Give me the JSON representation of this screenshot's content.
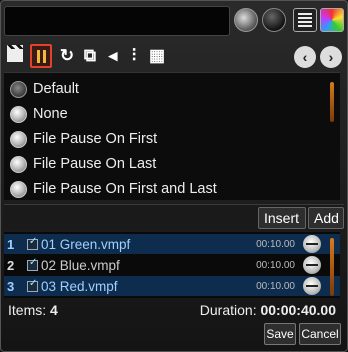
{
  "toolbar": {
    "icons": [
      "clapper-icon",
      "pause-icon",
      "refresh-icon",
      "insert-frame-icon",
      "reverse-icon",
      "split-icon",
      "film-icon"
    ],
    "active": "pause-icon"
  },
  "options": [
    {
      "label": "Default",
      "selected": true
    },
    {
      "label": "None",
      "selected": false
    },
    {
      "label": "File Pause On First",
      "selected": false
    },
    {
      "label": "File Pause On Last",
      "selected": false
    },
    {
      "label": "File Pause On First and Last",
      "selected": false
    }
  ],
  "list_buttons": {
    "insert": "Insert",
    "add": "Add"
  },
  "playlist": [
    {
      "num": "1",
      "name": "01 Green.vmpf",
      "duration": "00:10.00",
      "selected": true
    },
    {
      "num": "2",
      "name": "02 Blue.vmpf",
      "duration": "00:10.00",
      "selected": false
    },
    {
      "num": "3",
      "name": "03 Red.vmpf",
      "duration": "00:10.00",
      "selected": true
    }
  ],
  "footer": {
    "items_label": "Items:",
    "items_value": "4",
    "duration_label": "Duration:",
    "duration_value": "00:00:40.00"
  },
  "buttons": {
    "save": "Save",
    "cancel": "Cancel"
  },
  "colors": {
    "accent": "#e2422b",
    "selection": "#0e2c4e",
    "pause": "#f4b838"
  }
}
